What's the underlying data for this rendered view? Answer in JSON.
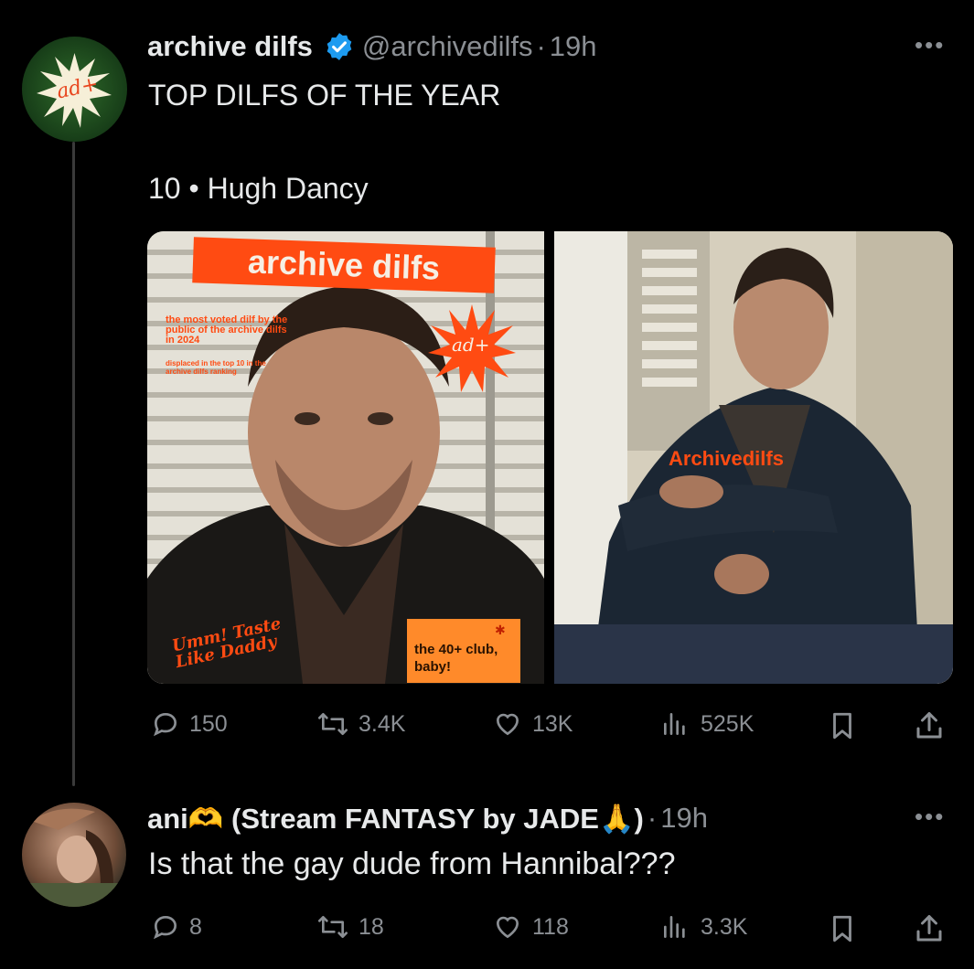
{
  "tweet1": {
    "display_name": "archive dilfs",
    "handle": "@archivedilfs",
    "separator": "·",
    "time": "19h",
    "avatar_text": "ad+",
    "text_line1": "TOP DILFS OF THE YEAR",
    "text_line2": "10 • Hugh Dancy",
    "image1": {
      "banner": "archive dilfs",
      "caption1": "the most voted dilf by the public of the archive dilfs in 2024",
      "caption2": "displaced in the top 10 in the archive dilfs ranking",
      "stamp": "ad+",
      "script_text": "Umm! Taste Like Daddy",
      "badge": "the 40+ club, baby!"
    },
    "image2": {
      "watermark": "Archivedilfs"
    },
    "actions": {
      "replies": "150",
      "reposts": "3.4K",
      "likes": "13K",
      "views": "525K"
    }
  },
  "tweet2": {
    "display_name": "ani🫶 (Stream FANTASY by JADE🙏)",
    "separator": "·",
    "time": "19h",
    "text": "Is that the gay dude from Hannibal???",
    "actions": {
      "replies": "8",
      "reposts": "18",
      "likes": "118",
      "views": "3.3K"
    }
  },
  "colors": {
    "accent": "#1d9bf0",
    "muted": "#8b8f94",
    "brand_orange": "#ff4b12"
  }
}
